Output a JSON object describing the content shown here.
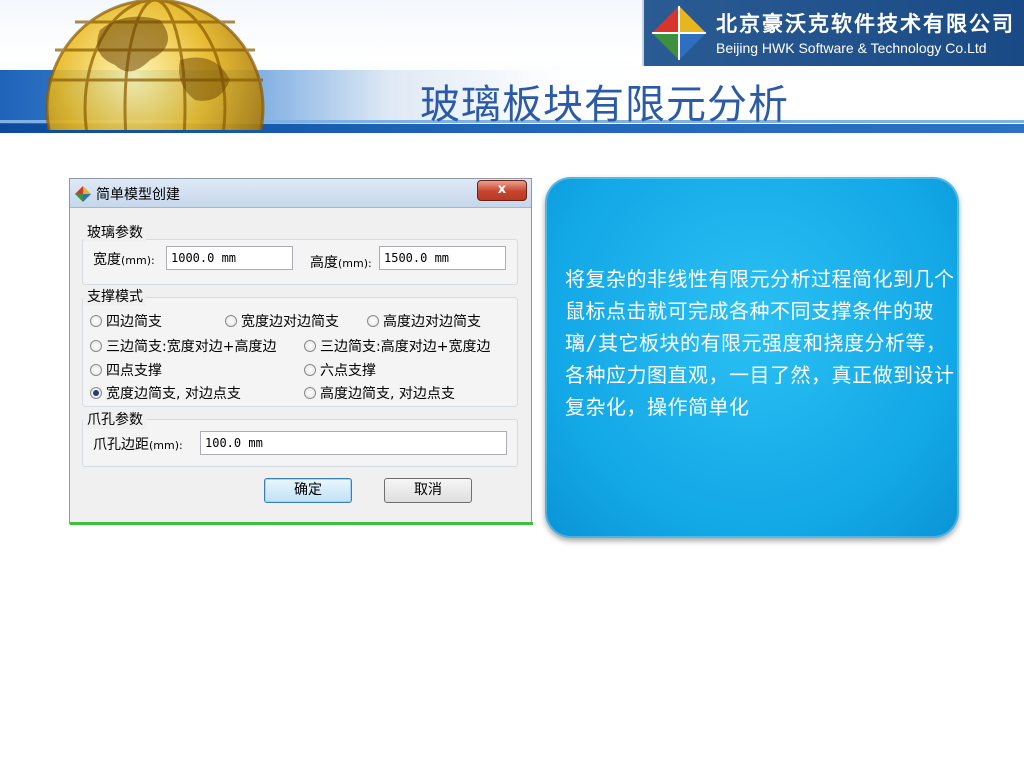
{
  "banner": {
    "company_cn": "北京豪沃克软件技术有限公司",
    "company_en": "Beijing HWK Software & Technology Co.Ltd",
    "page_title": "玻璃板块有限元分析"
  },
  "dialog": {
    "title": "简单模型创建",
    "close_label": "x",
    "glass_group": {
      "label": "玻璃参数",
      "width_label": "宽度",
      "width_unit": "(mm):",
      "width_value": "1000.0 mm",
      "height_label": "高度",
      "height_unit": "(mm):",
      "height_value": "1500.0 mm"
    },
    "support_group": {
      "label": "支撑模式",
      "options": [
        {
          "label": "四边简支",
          "checked": false
        },
        {
          "label": "宽度边对边简支",
          "checked": false
        },
        {
          "label": "高度边对边简支",
          "checked": false
        },
        {
          "label": "三边简支:宽度对边+高度边",
          "checked": false
        },
        {
          "label": "三边简支:高度对边+宽度边",
          "checked": false
        },
        {
          "label": "四点支撑",
          "checked": false
        },
        {
          "label": "六点支撑",
          "checked": false
        },
        {
          "label": "宽度边简支, 对边点支",
          "checked": true
        },
        {
          "label": "高度边简支, 对边点支",
          "checked": false
        }
      ]
    },
    "claw_group": {
      "label": "爪孔参数",
      "edge_label": "爪孔边距",
      "edge_unit": "(mm):",
      "edge_value": "100.0 mm"
    },
    "ok_label": "确定",
    "cancel_label": "取消"
  },
  "info_card": {
    "text": "将复杂的非线性有限元分析过程简化到几个鼠标点击就可完成各种不同支撑条件的玻璃/其它板块的有限元强度和挠度分析等，各种应力图直观，一目了然，真正做到设计复杂化，操作简单化"
  },
  "colors": {
    "title_blue": "#2a5aa8",
    "logo_bg": "#1a4a85",
    "card_blue": "#12a7e6"
  }
}
